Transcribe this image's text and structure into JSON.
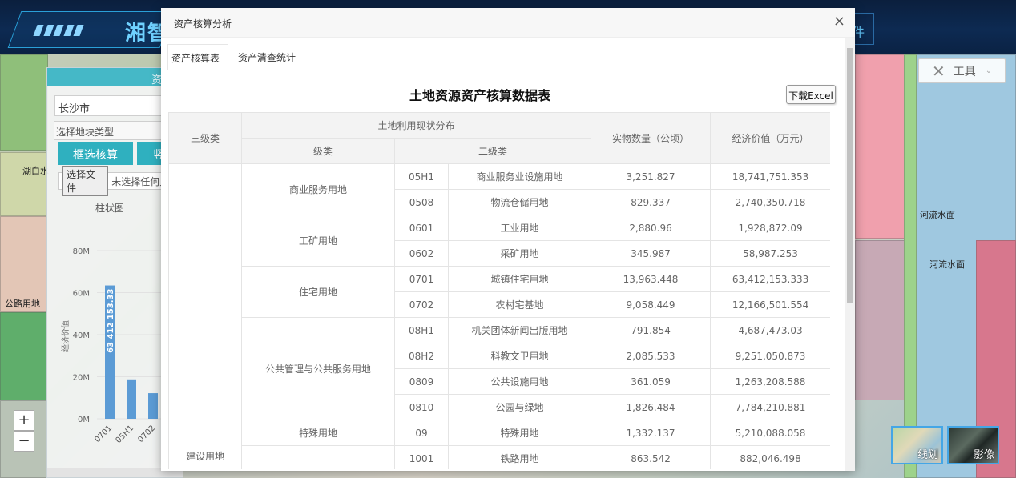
{
  "header": {
    "app_title": "湘智",
    "right_btn_text": "件"
  },
  "map": {
    "labels": [
      "湖白水",
      "公路用地",
      "河流水面",
      "河流水面"
    ],
    "tools_label": "工具",
    "basemaps": [
      "线划",
      "影像"
    ]
  },
  "left_panel": {
    "title": "资",
    "city": "长沙市",
    "type_placeholder": "选择地块类型",
    "btn_select_calc": "框选核算",
    "btn_second": "竖",
    "file_btn": "选择文件",
    "file_status": "未选择任何文件",
    "chart_title": "柱状图"
  },
  "chart_data": {
    "type": "bar",
    "title": "柱状图",
    "ylabel": "经济价值",
    "categories": [
      "0701",
      "05H1",
      "0702"
    ],
    "values": [
      63412153.333,
      18741751.353,
      12166501.554
    ],
    "ylim": [
      0,
      80000000
    ],
    "yticks": [
      "0M",
      "20M",
      "40M",
      "60M",
      "80M"
    ],
    "data_label": "63 412 153.33",
    "bar_color": "#5b9bd5"
  },
  "modal": {
    "title": "资产核算分析",
    "close": "×",
    "tabs": [
      "资产核算表",
      "资产清查统计"
    ],
    "table_title": "土地资源资产核算数据表",
    "excel_btn": "下载Excel",
    "headers": {
      "level3": "三级类",
      "current_use": "土地利用现状分布",
      "level1": "一级类",
      "level2": "二级类",
      "quantity": "实物数量（公顷）",
      "value": "经济价值（万元）"
    },
    "level3_group": "建设用地",
    "groups": [
      {
        "name": "商业服务用地",
        "rows": [
          {
            "code": "05H1",
            "name": "商业服务业设施用地",
            "qty": "3,251.827",
            "val": "18,741,751.353"
          },
          {
            "code": "0508",
            "name": "物流仓储用地",
            "qty": "829.337",
            "val": "2,740,350.718"
          }
        ]
      },
      {
        "name": "工矿用地",
        "rows": [
          {
            "code": "0601",
            "name": "工业用地",
            "qty": "2,880.96",
            "val": "1,928,872.09"
          },
          {
            "code": "0602",
            "name": "采矿用地",
            "qty": "345.987",
            "val": "58,987.253"
          }
        ]
      },
      {
        "name": "住宅用地",
        "rows": [
          {
            "code": "0701",
            "name": "城镇住宅用地",
            "qty": "13,963.448",
            "val": "63,412,153.333"
          },
          {
            "code": "0702",
            "name": "农村宅基地",
            "qty": "9,058.449",
            "val": "12,166,501.554"
          }
        ]
      },
      {
        "name": "公共管理与公共服务用地",
        "rows": [
          {
            "code": "08H1",
            "name": "机关团体新闻出版用地",
            "qty": "791.854",
            "val": "4,687,473.03"
          },
          {
            "code": "08H2",
            "name": "科教文卫用地",
            "qty": "2,085.533",
            "val": "9,251,050.873"
          },
          {
            "code": "0809",
            "name": "公共设施用地",
            "qty": "361.059",
            "val": "1,263,208.588"
          },
          {
            "code": "0810",
            "name": "公园与绿地",
            "qty": "1,826.484",
            "val": "7,784,210.881"
          }
        ]
      },
      {
        "name": "特殊用地",
        "rows": [
          {
            "code": "09",
            "name": "特殊用地",
            "qty": "1,332.137",
            "val": "5,210,088.058"
          }
        ]
      },
      {
        "name": "",
        "rows": [
          {
            "code": "1001",
            "name": "铁路用地",
            "qty": "863.542",
            "val": "882,046.498"
          }
        ]
      }
    ]
  }
}
